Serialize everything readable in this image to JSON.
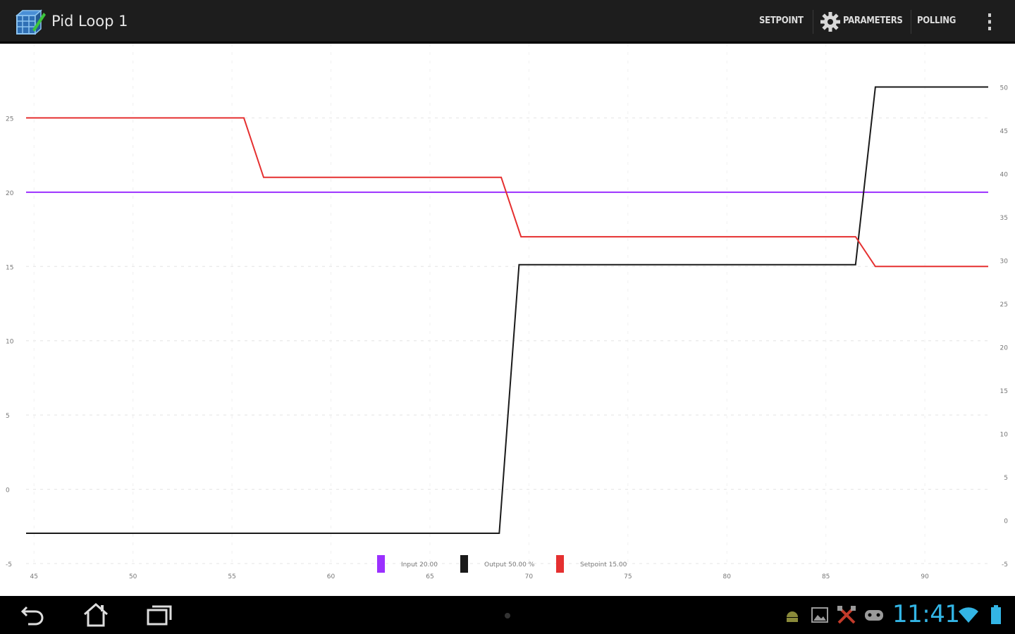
{
  "app": {
    "title": "Pid Loop 1"
  },
  "actionbar": {
    "setpoint_label": "SETPOINT",
    "parameters_label": "PARAMETERS",
    "polling_label": "POLLING",
    "icons": {
      "app": "app-icon",
      "gear": "gear-icon",
      "overflow": "overflow-menu-icon"
    }
  },
  "chart_data": {
    "type": "line",
    "x_ticks": [
      "45",
      "50",
      "55",
      "60",
      "65",
      "70",
      "75",
      "80",
      "85",
      "90"
    ],
    "y_left_ticks": [
      "-5",
      "0",
      "5",
      "10",
      "15",
      "20",
      "25"
    ],
    "y_right_ticks": [
      "-5",
      "0",
      "5",
      "10",
      "15",
      "20",
      "25",
      "30",
      "35",
      "40",
      "45",
      "50"
    ],
    "xlim": [
      44.6,
      93.2
    ],
    "ylim_left": [
      -5,
      30
    ],
    "ylim_right": [
      -5,
      55
    ],
    "grid": true,
    "legend_position": "bottom",
    "series": [
      {
        "name": "Input 20.00",
        "color": "#9b30ff",
        "axis": "left",
        "x": [
          44.6,
          93.2
        ],
        "y": [
          20,
          20
        ]
      },
      {
        "name": "Output 50.00 %",
        "color": "#1a1a1a",
        "axis": "right",
        "x": [
          44.6,
          68.5,
          69.5,
          86.5,
          87.5,
          93.2
        ],
        "y": [
          -1.5,
          -1.5,
          29.5,
          29.5,
          50,
          50
        ]
      },
      {
        "name": "Setpoint 15.00",
        "color": "#e53030",
        "axis": "left",
        "x": [
          44.6,
          55.6,
          56.6,
          68.6,
          69.6,
          86.5,
          87.5,
          93.2
        ],
        "y": [
          25,
          25,
          21,
          21,
          17,
          17,
          15,
          15
        ]
      }
    ]
  },
  "status": {
    "time": "11:41",
    "icons": [
      "android-icon",
      "gallery-icon",
      "tools-icon",
      "gamepad-icon",
      "wifi-icon",
      "battery-icon"
    ]
  },
  "nav": {
    "icons": [
      "back-icon",
      "home-icon",
      "recent-apps-icon"
    ]
  }
}
